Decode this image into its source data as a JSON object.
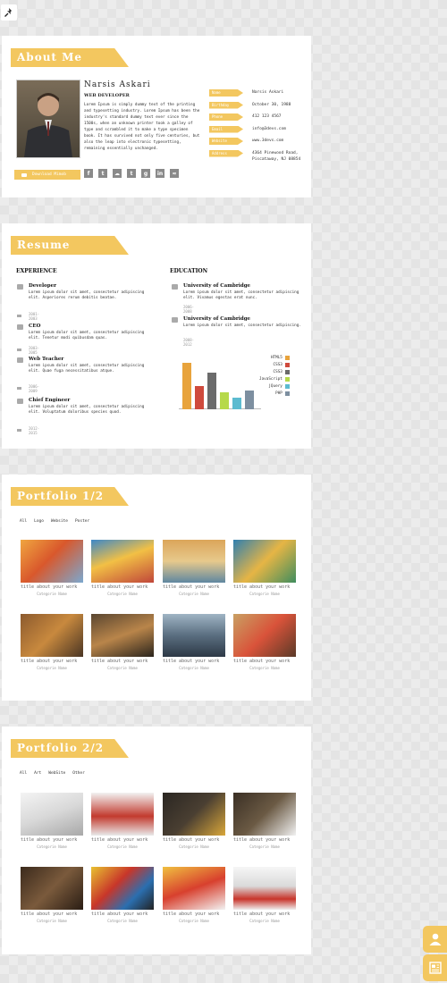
{
  "colors": {
    "accent": "#f3c75f",
    "page_bg": "#ececec"
  },
  "about": {
    "heading": "About Me",
    "name": "Narsis Askari",
    "job_title": "WEB DEVELOPER",
    "bio": "Lorem Ipsum is simply dummy text of the printing and typesetting industry. Lorem Ipsum has been the industry's standard dummy text ever since the 1500s, when an unknown printer took a galley of type and scrambled it to make a type specimen book. It has survived not only five centuries, but also the leap into electronic typesetting, remaining essentially unchanged.",
    "download_label": "Download Mimob",
    "socials": [
      "facebook-icon",
      "twitter-icon",
      "cloud-icon",
      "tumblr-icon",
      "google-plus-icon",
      "linkedin-icon",
      "rss-icon"
    ],
    "info": [
      {
        "label": "Name",
        "value": "Narsis Askari"
      },
      {
        "label": "Birthday",
        "value": "October 30, 1988"
      },
      {
        "label": "Phone",
        "value": "412 123 4567"
      },
      {
        "label": "Email",
        "value": "info@3devs.com"
      },
      {
        "label": "Website",
        "value": "www.3devs.com"
      },
      {
        "label": "Address",
        "value": "4364 Pinewood Road, Piscataway, NJ 08854"
      }
    ]
  },
  "resume": {
    "heading": "Resume",
    "experience_heading": "EXPERIENCE",
    "education_heading": "EDUCATION",
    "experience": [
      {
        "title": "Developer",
        "desc": "Lorem ipsum dolor sit amet, consectetur adipiscing elit. Asperiores rerum debitis beatae.",
        "date": "2001-2003"
      },
      {
        "title": "CEO",
        "desc": "Lorem ipsum dolor sit amet, consectetur adipiscing elit. Tenetur modi quibusdam quas.",
        "date": "2003-2005"
      },
      {
        "title": "Web Teacher",
        "desc": "Lorem ipsum dolor sit amet, consectetur adipiscing elit. Quae fuga necessitatibus atque.",
        "date": "2006-2009"
      },
      {
        "title": "Chief Engineer",
        "desc": "Lorem ipsum dolor sit amet, consectetur adipiscing elit. Voluptatum doloribus species quod.",
        "date": "2012-2015"
      }
    ],
    "education": [
      {
        "title": "University of Cambridge",
        "desc": "Lorem ipsum dolor sit amet, consectetur adipiscing elit. Vivamus egestas erat nunc.",
        "date": "2006-2008"
      },
      {
        "title": "University of Cambridge",
        "desc": "Lorem ipsum dolor sit amet, consectetur adipiscing.",
        "date": "2008-2012"
      }
    ]
  },
  "chart_data": {
    "type": "bar",
    "categories": [
      "HTML5",
      "CSS3",
      "CSS3",
      "JavaScript",
      "jQuery",
      "PHP"
    ],
    "values": [
      90,
      45,
      70,
      32,
      22,
      36
    ],
    "colors": [
      "#e8a33c",
      "#cf4a3c",
      "#6b6b6b",
      "#b6d94a",
      "#5cbbd0",
      "#7d8fa0"
    ],
    "legend": [
      "HTML5",
      "CSS3",
      "CSS3",
      "JavaScript",
      "jQuery",
      "PHP"
    ],
    "ylim": [
      0,
      100
    ],
    "legend_position": "right"
  },
  "portfolio1": {
    "heading": "Portfolio 1/2",
    "filters": [
      "All",
      "Logo",
      "Website",
      "Poster"
    ],
    "items": [
      {
        "title": "title about your work",
        "category": "Categorie Name"
      },
      {
        "title": "title about your work",
        "category": "Categorie Name"
      },
      {
        "title": "title about your work",
        "category": "Categorie Name"
      },
      {
        "title": "title about your work",
        "category": "Categorie Name"
      },
      {
        "title": "title about your work",
        "category": "Categorie Name"
      },
      {
        "title": "title about your work",
        "category": "Categorie Name"
      },
      {
        "title": "title about your work",
        "category": "Categorie Name"
      },
      {
        "title": "title about your work",
        "category": "Categorie Name"
      }
    ]
  },
  "portfolio2": {
    "heading": "Portfolio 2/2",
    "filters": [
      "All",
      "Art",
      "WebSite",
      "Other"
    ],
    "items": [
      {
        "title": "title about your work",
        "category": "Categorie Name"
      },
      {
        "title": "title about your work",
        "category": "Categorie Name"
      },
      {
        "title": "title about your work",
        "category": "Categorie Name"
      },
      {
        "title": "title about your work",
        "category": "Categorie Name"
      },
      {
        "title": "title about your work",
        "category": "Categorie Name"
      },
      {
        "title": "title about your work",
        "category": "Categorie Name"
      },
      {
        "title": "title about your work",
        "category": "Categorie Name"
      },
      {
        "title": "title about your work",
        "category": "Categorie Name"
      }
    ]
  },
  "floating_buttons": [
    "user-icon",
    "newspaper-icon"
  ]
}
